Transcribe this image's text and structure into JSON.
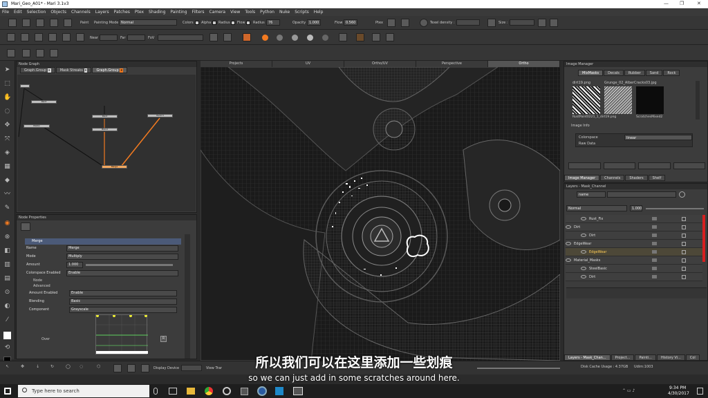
{
  "window": {
    "title": "Mari_Geo_A01* - Mari 3.1v3"
  },
  "menu": [
    "File",
    "Edit",
    "Selection",
    "Objects",
    "Channels",
    "Layers",
    "Patches",
    "Ptex",
    "Shading",
    "Painting",
    "Filters",
    "Camera",
    "View",
    "Tools",
    "Python",
    "Nuke",
    "Scripts",
    "Help"
  ],
  "toolbar1": {
    "paint_label": "Paint",
    "painting_mode_label": "Painting Mode",
    "painting_mode_value": "Normal",
    "colors_label": "Colors",
    "alpha_label": "Alpha",
    "radius_label": "Radius",
    "flow_label": "Flow",
    "radius2_label": "Radius",
    "radius_value": "76",
    "opacity_label": "Opacity",
    "opacity_value": "1.000",
    "flow2_label": "Flow",
    "flow_value": "0.560",
    "ptex_label": "Ptex",
    "texel_label": "Texel density :",
    "size_label": "Size :"
  },
  "toolbar2": {
    "near_label": "Near",
    "far_label": "Far",
    "fov_label": "FoV"
  },
  "node_graph": {
    "title": "Node Graph",
    "tabs": [
      "Graph.Group",
      "Mask Streaks",
      "Graph.Group"
    ],
    "nodes": [
      "Paint",
      "Matrix",
      "Paint",
      "Blend",
      "Paint 3",
      "Merge"
    ]
  },
  "node_properties": {
    "title": "Node Properties",
    "section": "Merge",
    "name_label": "Name",
    "name_value": "Merge",
    "mode_label": "Mode",
    "mode_value": "Multiply",
    "amount_label": "Amount",
    "amount_value": "1.000",
    "colorspace_label": "Colorspace Enabled",
    "colorspace_value": "Enable",
    "node_group": "Node",
    "advanced_group": "Advanced",
    "amount_enabled_label": "Amount Enabled",
    "amount_enabled_value": "Enable",
    "blending_label": "Blending",
    "blending_value": "Basic",
    "component_label": "Component",
    "component_value": "Grayscale",
    "over_label": "Over"
  },
  "viewport": {
    "tabs": [
      "Projects",
      "UV",
      "Ortho/UV",
      "Perspective",
      "Ortho"
    ],
    "active_tab": "Ortho"
  },
  "image_manager": {
    "title": "Image Manager",
    "tabs": [
      "MixMasks",
      "Decals",
      "Rubber",
      "Sand",
      "Rock"
    ],
    "thumbs": [
      "RustPaint0221_1_dirt19.png",
      "dirt19.png",
      "ScratchesMixed2"
    ],
    "top_labels": [
      "dirt19.png",
      "Grunge_02_Alber",
      "Cracks03.jpg"
    ],
    "info_title": "Image Info",
    "colorspace_label": "Colorspace",
    "colorspace_value": "linear",
    "raw_label": "Raw Data",
    "bottom_tabs": [
      "Image Manager",
      "Channels",
      "Shaders",
      "Shelf"
    ]
  },
  "layers": {
    "title": "Layers - Mask_Channel",
    "search_field": "name",
    "blend_mode": "Normal",
    "opacity": "1.000",
    "items": [
      "Rust_Fix",
      "Dirt",
      "Dirt",
      "EdgeWear",
      "EdgeWear",
      "Material_Masks",
      "SteelBasic",
      "Dirt"
    ],
    "selected_index": 4
  },
  "bottom_bar": {
    "display_device_label": "Display Device",
    "view_transform_label": "View Trar",
    "disk_cache": "Disk Cache Usage : 4.37GB",
    "udim": "Udim:1003",
    "tabs": [
      "Layers - Mask_Chan...",
      "Project...",
      "Painti...",
      "History Vi...",
      "Col"
    ]
  },
  "taskbar": {
    "search_placeholder": "Type here to search",
    "time": "9:34 PM",
    "date": "4/30/2017"
  },
  "subtitle": {
    "zh": "所以我们可以在这里添加一些划痕",
    "en": "so we can just add in some scratches around here."
  }
}
